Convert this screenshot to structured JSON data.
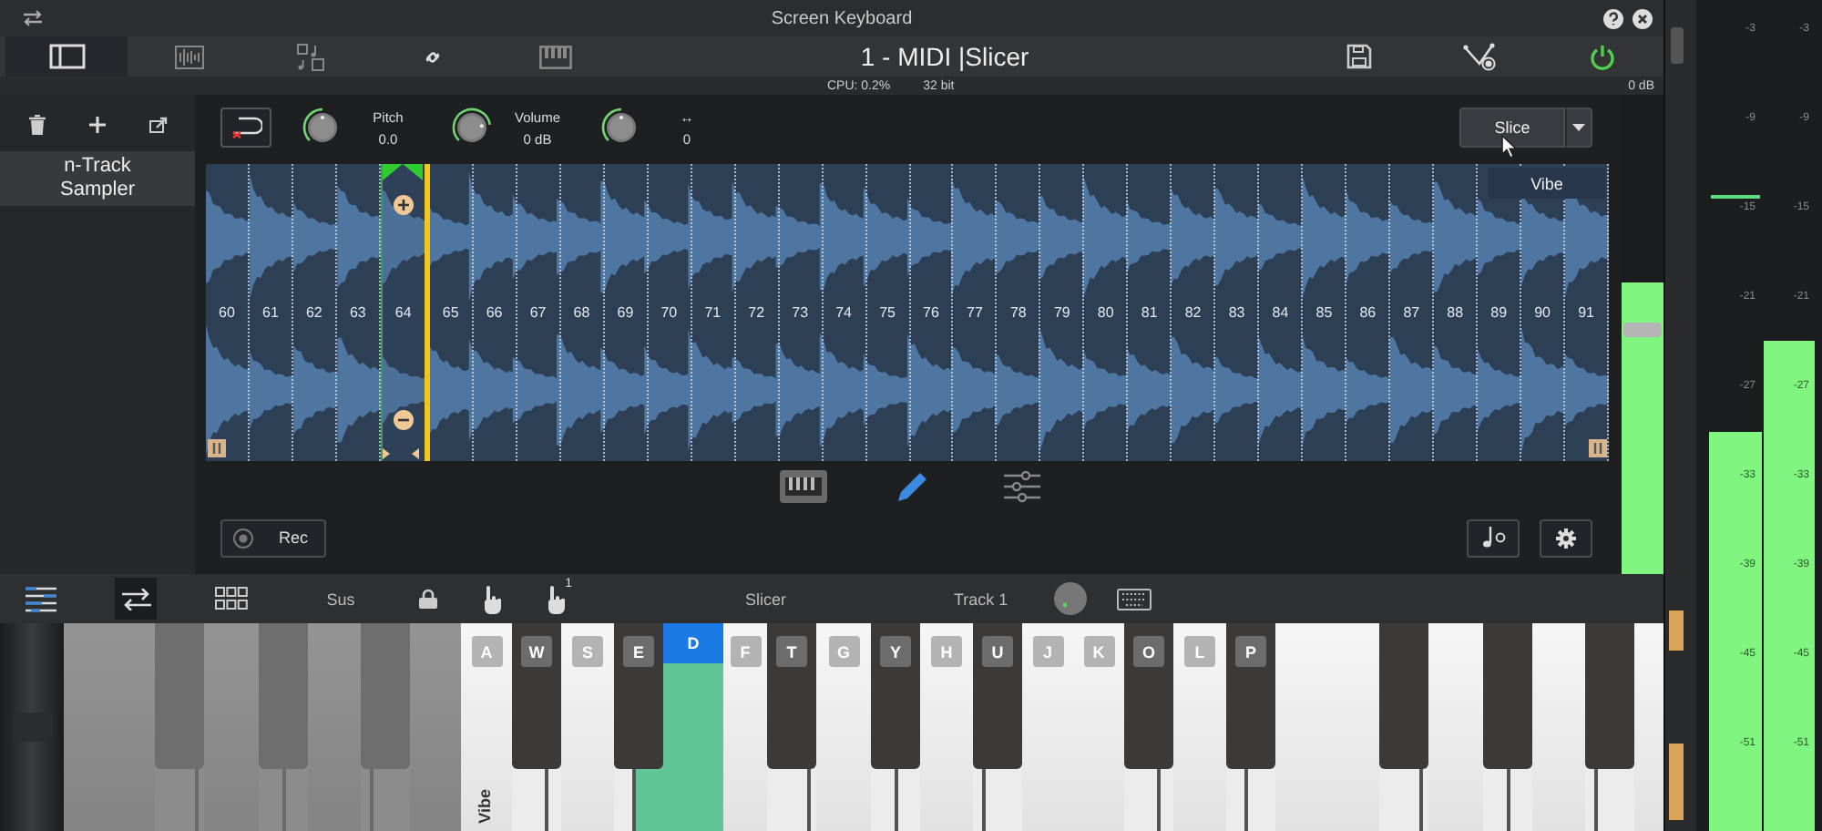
{
  "window": {
    "title": "Screen Keyboard"
  },
  "toolbar": {
    "tabs": [
      {
        "kind": "panel",
        "selected": true
      },
      {
        "kind": "waveform",
        "selected": false
      },
      {
        "kind": "shapes",
        "selected": false
      },
      {
        "kind": "link",
        "selected": false
      },
      {
        "kind": "piano",
        "selected": false
      }
    ],
    "title": "1 - MIDI |Slicer",
    "power_on": true
  },
  "status": {
    "cpu": "CPU: 0.2%",
    "bits": "32 bit",
    "gain": "0 dB"
  },
  "sidebar": {
    "items": [
      {
        "label": "n-Track Sampler",
        "selected": true
      }
    ]
  },
  "controls": {
    "knobs": [
      {
        "label": "Pitch",
        "value": "0.0",
        "level": 0.5
      },
      {
        "label": "Volume",
        "value": "0 dB",
        "level": 0.8
      },
      {
        "label": "↔",
        "value": "0",
        "level": 0.5
      }
    ],
    "slice_button": "Slice"
  },
  "slices": [
    {
      "label": "60",
      "selected": false
    },
    {
      "label": "61",
      "selected": false
    },
    {
      "label": "62",
      "selected": false
    },
    {
      "label": "63",
      "selected": false
    },
    {
      "label": "64",
      "selected": true
    },
    {
      "label": "65",
      "selected": false
    },
    {
      "label": "66",
      "selected": false
    },
    {
      "label": "67",
      "selected": false
    },
    {
      "label": "68",
      "selected": false
    },
    {
      "label": "69",
      "selected": false
    },
    {
      "label": "70",
      "selected": false
    },
    {
      "label": "71",
      "selected": false
    },
    {
      "label": "72",
      "selected": false
    },
    {
      "label": "73",
      "selected": false
    },
    {
      "label": "74",
      "selected": false
    },
    {
      "label": "75",
      "selected": false
    },
    {
      "label": "76",
      "selected": false
    },
    {
      "label": "77",
      "selected": false
    },
    {
      "label": "78",
      "selected": false
    },
    {
      "label": "79",
      "selected": false
    },
    {
      "label": "80",
      "selected": false
    },
    {
      "label": "81",
      "selected": false
    },
    {
      "label": "82",
      "selected": false
    },
    {
      "label": "83",
      "selected": false
    },
    {
      "label": "84",
      "selected": false
    },
    {
      "label": "85",
      "selected": false
    },
    {
      "label": "86",
      "selected": false
    },
    {
      "label": "87",
      "selected": false
    },
    {
      "label": "88",
      "selected": false
    },
    {
      "label": "89",
      "selected": false
    },
    {
      "label": "90",
      "selected": false
    },
    {
      "label": "91",
      "selected": false
    }
  ],
  "waveform_label": "Vibe",
  "mode_tabs": [
    {
      "kind": "piano",
      "selected": false
    },
    {
      "kind": "pencil",
      "selected": true
    },
    {
      "kind": "sliders",
      "selected": false
    }
  ],
  "rec_button": "Rec",
  "meter": {
    "level": 0.61,
    "fader": {
      "level": 0.51
    }
  },
  "keyboard_toolbar": {
    "swap_on": true,
    "sustain": "Sus",
    "hand_count": "1",
    "instrument": "Slicer",
    "track": "Track 1"
  },
  "piano": {
    "keys": [
      {
        "kind": "white",
        "dimmed": true,
        "pressed": false
      },
      {
        "kind": "white",
        "dimmed": true,
        "pressed": false
      },
      {
        "kind": "black",
        "dimmed": true,
        "pressed": false
      },
      {
        "kind": "white",
        "dimmed": true,
        "pressed": false
      },
      {
        "kind": "black",
        "dimmed": true,
        "pressed": false
      },
      {
        "kind": "white",
        "dimmed": true,
        "pressed": false
      },
      {
        "kind": "black",
        "dimmed": true,
        "pressed": false
      },
      {
        "kind": "white",
        "dimmed": true,
        "pressed": false
      },
      {
        "kind": "white",
        "label": "A",
        "zone_label": "Vibe",
        "dimmed": false,
        "pressed": false
      },
      {
        "kind": "black",
        "label": "W",
        "dimmed": false,
        "pressed": false
      },
      {
        "kind": "white",
        "label": "S",
        "dimmed": false,
        "pressed": false
      },
      {
        "kind": "black",
        "label": "E",
        "dimmed": false,
        "pressed": false
      },
      {
        "kind": "white",
        "label": "D",
        "dimmed": false,
        "pressed": true
      },
      {
        "kind": "white",
        "label": "F",
        "dimmed": false,
        "pressed": false
      },
      {
        "kind": "black",
        "label": "T",
        "dimmed": false,
        "pressed": false
      },
      {
        "kind": "white",
        "label": "G",
        "dimmed": false,
        "pressed": false
      },
      {
        "kind": "black",
        "label": "Y",
        "dimmed": false,
        "pressed": false
      },
      {
        "kind": "white",
        "label": "H",
        "dimmed": false,
        "pressed": false
      },
      {
        "kind": "black",
        "label": "U",
        "dimmed": false,
        "pressed": false
      },
      {
        "kind": "white",
        "label": "J",
        "dimmed": false,
        "pressed": false
      },
      {
        "kind": "white",
        "label": "K",
        "dimmed": false,
        "pressed": false
      },
      {
        "kind": "black",
        "label": "O",
        "dimmed": false,
        "pressed": false
      },
      {
        "kind": "white",
        "label": "L",
        "dimmed": false,
        "pressed": false
      },
      {
        "kind": "black",
        "label": "P",
        "dimmed": false,
        "pressed": false
      },
      {
        "kind": "white",
        "dimmed": false,
        "pressed": false
      },
      {
        "kind": "white",
        "dimmed": false,
        "pressed": false
      },
      {
        "kind": "black",
        "dimmed": false,
        "pressed": false
      },
      {
        "kind": "white",
        "dimmed": false,
        "pressed": false
      },
      {
        "kind": "black",
        "dimmed": false,
        "pressed": false
      },
      {
        "kind": "white",
        "dimmed": false,
        "pressed": false
      },
      {
        "kind": "black",
        "dimmed": false,
        "pressed": false
      },
      {
        "kind": "white",
        "dimmed": false,
        "pressed": false
      }
    ]
  },
  "master_meters": [
    {
      "level": 0.48,
      "peak": {
        "level": 0.76
      },
      "scale": [
        "-3",
        "-9",
        "-15",
        "-21",
        "-27",
        "-33",
        "-39",
        "-45",
        "-51"
      ]
    },
    {
      "level": 0.59,
      "scale": [
        "-3",
        "-9",
        "-15",
        "-21",
        "-27",
        "-33",
        "-39",
        "-45",
        "-51"
      ]
    }
  ]
}
